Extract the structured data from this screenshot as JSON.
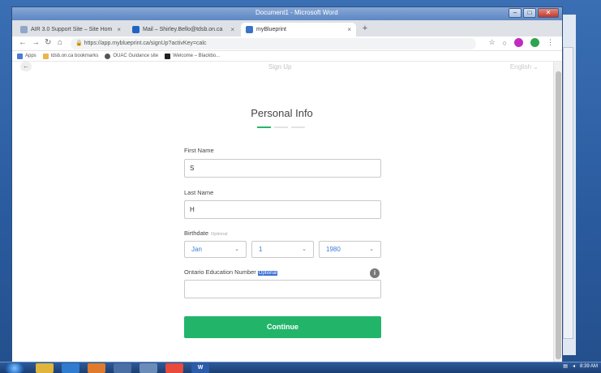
{
  "window": {
    "title": "Document1 - Microsoft Word"
  },
  "browser": {
    "tabs": [
      {
        "label": "AIR 3.0 Support Site – Site Hom"
      },
      {
        "label": "Mail – Shirley.Bello@tdsb.on.ca"
      },
      {
        "label": "myBlueprint"
      }
    ],
    "url": "https://app.myblueprint.ca/signUp?activKey=calc",
    "bookmarks": [
      {
        "label": "Apps"
      },
      {
        "label": "tdsb.on.ca bookmarks"
      },
      {
        "label": "OUAC Guidance site"
      },
      {
        "label": "Welcome – Blackbo..."
      }
    ]
  },
  "page": {
    "top_title": "Sign Up",
    "language": "English",
    "heading": "Personal Info",
    "steps": {
      "current": 1,
      "total": 3
    },
    "first_name": {
      "label": "First Name",
      "value": "S"
    },
    "last_name": {
      "label": "Last Name",
      "value": "H"
    },
    "birthdate": {
      "label": "Birthdate",
      "optional": "Optional",
      "month": "Jan",
      "day": "1",
      "year": "1980"
    },
    "oen": {
      "label": "Ontario Education Number",
      "optional": "Optional",
      "value": ""
    },
    "continue_label": "Continue"
  },
  "taskbar": {
    "time": "8:39 AM",
    "word_label": "W"
  },
  "colors": {
    "accent_green": "#22b56a",
    "select_text": "#3a7bd5",
    "highlight": "#3a6fd8"
  },
  "icons": [
    "back-arrow-icon",
    "forward-arrow-icon",
    "reload-icon",
    "home-icon",
    "lock-icon",
    "star-icon",
    "info-icon",
    "chevron-down-icon",
    "windows-start-icon"
  ]
}
